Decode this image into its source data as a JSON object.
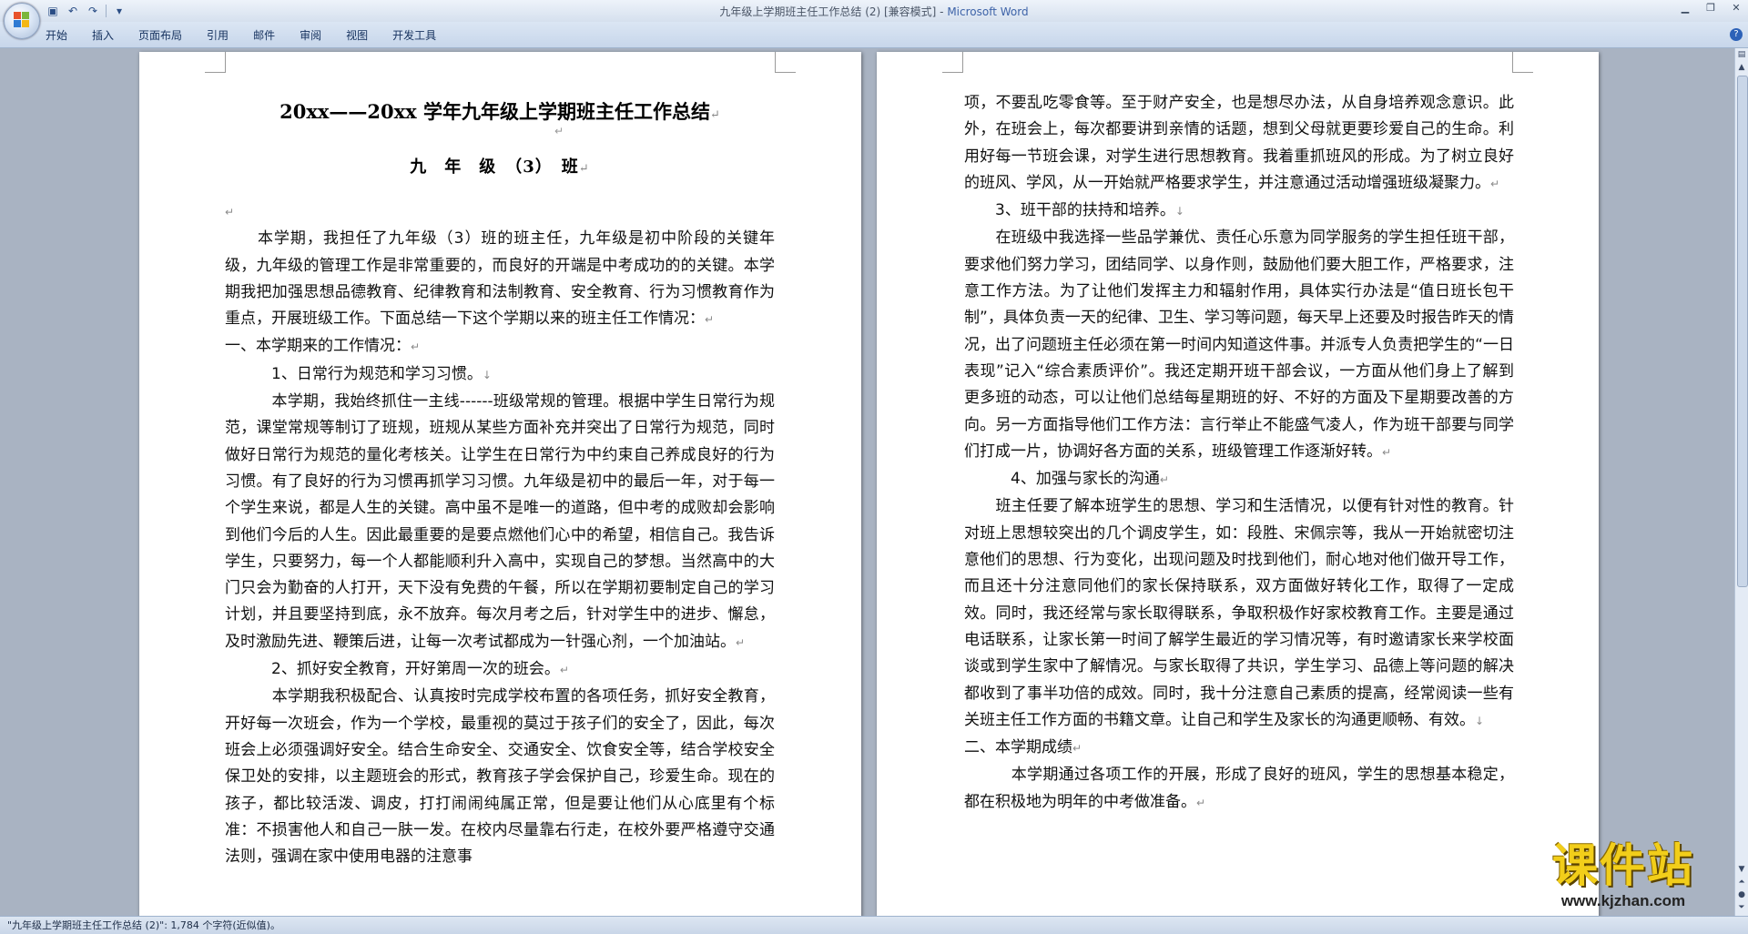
{
  "window": {
    "title_doc": "九年级上学期班主任工作总结 (2) [兼容模式] - ",
    "title_app": "Microsoft Word"
  },
  "qat": {
    "save_icon": "save-icon",
    "undo_icon": "undo-icon",
    "redo_icon": "redo-icon"
  },
  "ribbon": {
    "tabs": [
      "开始",
      "插入",
      "页面布局",
      "引用",
      "邮件",
      "审阅",
      "视图",
      "开发工具"
    ]
  },
  "doc": {
    "title": "20xx——20xx 学年九年级上学期班主任工作总结",
    "class_line": "九　年　级　（3）　班",
    "left_paragraphs": [
      "　　本学期，我担任了九年级（3）班的班主任，九年级是初中阶段的关键年级，九年级的管理工作是非常重要的，而良好的开端是中考成功的的关键。本学期我把加强思想品德教育、纪律教育和法制教育、安全教育、行为习惯教育作为重点，开展班级工作。下面总结一下这个学期以来的班主任工作情况：",
      "一、本学期来的工作情况：",
      "　　　1、日常行为规范和学习习惯。",
      "　　　本学期，我始终抓住一主线------班级常规的管理。根据中学生日常行为规范，课堂常规等制订了班规，班规从某些方面补充并突出了日常行为规范，同时做好日常行为规范的量化考核关。让学生在日常行为中约束自己养成良好的行为习惯。有了良好的行为习惯再抓学习习惯。九年级是初中的最后一年，对于每一个学生来说，都是人生的关键。高中虽不是唯一的道路，但中考的成败却会影响到他们今后的人生。因此最重要的是要点燃他们心中的希望，相信自己。我告诉学生，只要努力，每一个人都能顺利升入高中，实现自己的梦想。当然高中的大门只会为勤奋的人打开，天下没有免费的午餐，所以在学期初要制定自己的学习计划，并且要坚持到底，永不放弃。每次月考之后，针对学生中的进步、懈怠，及时激励先进、鞭策后进，让每一次考试都成为一针强心剂，一个加油站。",
      "　　　2、抓好安全教育，开好第周一次的班会。",
      "　　　本学期我积极配合、认真按时完成学校布置的各项任务，抓好安全教育，开好每一次班会，作为一个学校，最重视的莫过于孩子们的安全了，因此，每次班会上必须强调好安全。结合生命安全、交通安全、饮食安全等，结合学校安全保卫处的安排，以主题班会的形式，教育孩子学会保护自己，珍爱生命。现在的孩子，都比较活泼、调皮，打打闹闹纯属正常，但是要让他们从心底里有个标准：不损害他人和自己一肤一发。在校内尽量靠右行走，在校外要严格遵守交通法则，强调在家中使用电器的注意事"
    ],
    "right_paragraphs": [
      "项，不要乱吃零食等。至于财产安全，也是想尽办法，从自身培养观念意识。此外，在班会上，每次都要讲到亲情的话题，想到父母就更要珍爱自己的生命。利用好每一节班会课，对学生进行思想教育。我着重抓班风的形成。为了树立良好的班风、学风，从一开始就严格要求学生，并注意通过活动增强班级凝聚力。",
      "　　3、班干部的扶持和培养。",
      "　　在班级中我选择一些品学兼优、责任心乐意为同学服务的学生担任班干部，要求他们努力学习，团结同学、以身作则，鼓励他们要大胆工作，严格要求，注意工作方法。为了让他们发挥主力和辐射作用，具体实行办法是“值日班长包干制”，具体负责一天的纪律、卫生、学习等问题，每天早上还要及时报告昨天的情况，出了问题班主任必须在第一时间内知道这件事。并派专人负责把学生的“一日表现”记入“综合素质评价”。我还定期开班干部会议，一方面从他们身上了解到更多班的动态，可以让他们总结每星期班的好、不好的方面及下星期要改善的方向。另一方面指导他们工作方法：言行举止不能盛气凌人，作为班干部要与同学们打成一片，协调好各方面的关系，班级管理工作逐渐好转。",
      "　　　4、加强与家长的沟通",
      "　　班主任要了解本班学生的思想、学习和生活情况，以便有针对性的教育。针对班上思想较突出的几个调皮学生，如：段胜、宋佩宗等，我从一开始就密切注意他们的思想、行为变化，出现问题及时找到他们，耐心地对他们做开导工作，而且还十分注意同他们的家长保持联系，双方面做好转化工作，取得了一定成效。同时，我还经常与家长取得联系，争取积极作好家校教育工作。主要是通过电话联系，让家长第一时间了解学生最近的学习情况等，有时邀请家长来学校面谈或到学生家中了解情况。与家长取得了共识，学生学习、品德上等问题的解决都收到了事半功倍的成效。同时，我十分注意自己素质的提高，经常阅读一些有关班主任工作方面的书籍文章。让自己和学生及家长的沟通更顺畅、有效。",
      "二、本学期成绩",
      "　　　本学期通过各项工作的开展，形成了良好的班风，学生的思想基本稳定，都在积极地为明年的中考做准备。"
    ]
  },
  "status": {
    "text": "\"九年级上学期班主任工作总结 (2)\": 1,784 个字符(近似值)。"
  },
  "watermark": {
    "big": "课件站",
    "small": "www.kjzhan.com"
  }
}
